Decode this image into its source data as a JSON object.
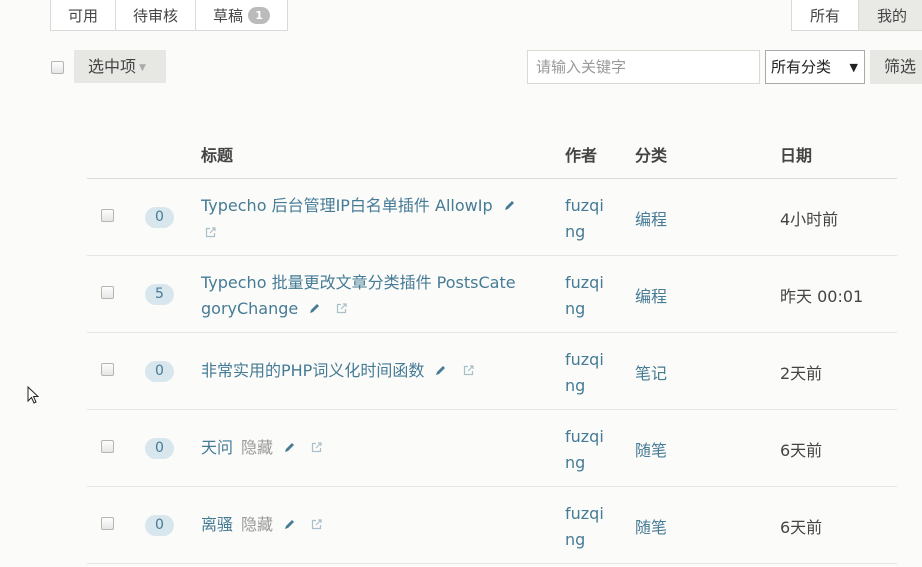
{
  "status_tabs": [
    {
      "label": "可用",
      "active": false
    },
    {
      "label": "待审核",
      "active": false
    },
    {
      "label": "草稿",
      "active": false,
      "badge": "1"
    }
  ],
  "scope_tabs": [
    {
      "label": "所有",
      "active": false
    },
    {
      "label": "我的",
      "active": true
    }
  ],
  "toolbar": {
    "selection_label": "选中项",
    "search_placeholder": "请输入关键字",
    "category_selected": "所有分类",
    "filter_label": "筛选"
  },
  "table": {
    "headers": {
      "title": "标题",
      "author": "作者",
      "category": "分类",
      "date": "日期"
    },
    "rows": [
      {
        "comments": "0",
        "title_line1": "Typecho 后台管理IP白名单插件 AllowIp",
        "title_line2": "",
        "hidden": "",
        "author_line1": "fuzqi",
        "author_line2": "ng",
        "category": "编程",
        "date": "4小时前"
      },
      {
        "comments": "5",
        "title_line1": "Typecho 批量更改文章分类插件 PostsCate",
        "title_line2": "goryChange",
        "hidden": "",
        "author_line1": "fuzqi",
        "author_line2": "ng",
        "category": "编程",
        "date": "昨天 00:01"
      },
      {
        "comments": "0",
        "title_line1": "非常实用的PHP词义化时间函数",
        "title_line2": "",
        "hidden": "",
        "author_line1": "fuzqi",
        "author_line2": "ng",
        "category": "笔记",
        "date": "2天前"
      },
      {
        "comments": "0",
        "title_line1": "天问",
        "title_line2": "",
        "hidden": "隐藏",
        "author_line1": "fuzqi",
        "author_line2": "ng",
        "category": "随笔",
        "date": "6天前"
      },
      {
        "comments": "0",
        "title_line1": "离骚",
        "title_line2": "",
        "hidden": "隐藏",
        "author_line1": "fuzqi",
        "author_line2": "ng",
        "category": "随笔",
        "date": "6天前"
      }
    ]
  },
  "colors": {
    "link": "#467b96",
    "badge_bg": "#d8e6ee"
  },
  "icons": {
    "edit": "pencil-icon",
    "open": "external-link-icon"
  }
}
